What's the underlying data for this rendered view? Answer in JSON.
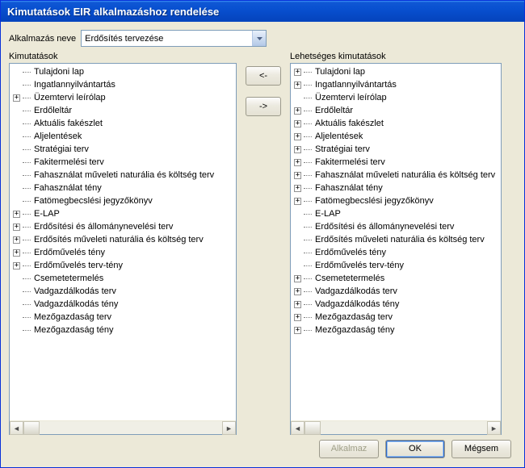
{
  "window": {
    "title": "Kimutatások EIR alkalmazáshoz rendelése"
  },
  "topRow": {
    "label": "Alkalmazás neve",
    "selected": "Erdősítés tervezése"
  },
  "columns": {
    "leftTitle": "Kimutatások",
    "rightTitle": "Lehetséges kimutatások"
  },
  "buttons": {
    "moveLeft": "<-",
    "moveRight": "->",
    "apply": "Alkalmaz",
    "ok": "OK",
    "cancel": "Mégsem"
  },
  "leftTree": [
    {
      "label": "Tulajdoni lap",
      "exp": null
    },
    {
      "label": "Ingatlannyilvántartás",
      "exp": null
    },
    {
      "label": "Üzemtervi leírólap",
      "exp": "＋"
    },
    {
      "label": "Erdőleltár",
      "exp": null
    },
    {
      "label": "Aktuális fakészlet",
      "exp": null
    },
    {
      "label": "Aljelentések",
      "exp": null
    },
    {
      "label": "Stratégiai terv",
      "exp": null
    },
    {
      "label": "Fakitermelési terv",
      "exp": null
    },
    {
      "label": "Fahasználat műveleti naturália és költség terv",
      "exp": null
    },
    {
      "label": "Fahasználat tény",
      "exp": null
    },
    {
      "label": "Fatömegbecslési jegyzőkönyv",
      "exp": null
    },
    {
      "label": "E-LAP",
      "exp": "＋"
    },
    {
      "label": "Erdősítési és állománynevelési terv",
      "exp": "＋"
    },
    {
      "label": "Erdősítés műveleti naturália és költség terv",
      "exp": "＋"
    },
    {
      "label": "Erdőművelés tény",
      "exp": "＋"
    },
    {
      "label": "Erdőművelés terv-tény",
      "exp": "＋"
    },
    {
      "label": "Csemetetermelés",
      "exp": null
    },
    {
      "label": "Vadgazdálkodás terv",
      "exp": null
    },
    {
      "label": "Vadgazdálkodás tény",
      "exp": null
    },
    {
      "label": "Mezőgazdaság terv",
      "exp": null
    },
    {
      "label": "Mezőgazdaság tény",
      "exp": null
    }
  ],
  "rightTree": [
    {
      "label": "Tulajdoni lap",
      "exp": "＋"
    },
    {
      "label": "Ingatlannyilvántartás",
      "exp": "＋"
    },
    {
      "label": "Üzemtervi leírólap",
      "exp": null
    },
    {
      "label": "Erdőleltár",
      "exp": "＋"
    },
    {
      "label": "Aktuális fakészlet",
      "exp": "＋"
    },
    {
      "label": "Aljelentések",
      "exp": "＋"
    },
    {
      "label": "Stratégiai terv",
      "exp": "＋"
    },
    {
      "label": "Fakitermelési terv",
      "exp": "＋"
    },
    {
      "label": "Fahasználat műveleti naturália és költség terv",
      "exp": "＋"
    },
    {
      "label": "Fahasználat tény",
      "exp": "＋"
    },
    {
      "label": "Fatömegbecslési jegyzőkönyv",
      "exp": "＋"
    },
    {
      "label": "E-LAP",
      "exp": null
    },
    {
      "label": "Erdősítési és állománynevelési terv",
      "exp": null
    },
    {
      "label": "Erdősítés műveleti naturália és költség terv",
      "exp": null
    },
    {
      "label": "Erdőművelés tény",
      "exp": null
    },
    {
      "label": "Erdőművelés terv-tény",
      "exp": null
    },
    {
      "label": "Csemetetermelés",
      "exp": "＋"
    },
    {
      "label": "Vadgazdálkodás terv",
      "exp": "＋"
    },
    {
      "label": "Vadgazdálkodás tény",
      "exp": "＋"
    },
    {
      "label": "Mezőgazdaság terv",
      "exp": "＋"
    },
    {
      "label": "Mezőgazdaság tény",
      "exp": "＋"
    }
  ]
}
